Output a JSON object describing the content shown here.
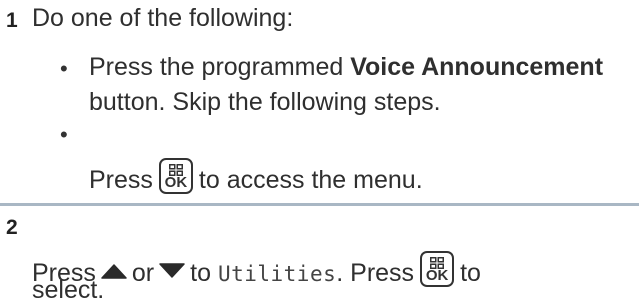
{
  "step1": {
    "number": "1",
    "intro": "Do one of the following:",
    "bullet1": {
      "pre": "Press the programmed ",
      "bold": "Voice Announcement",
      "line2": "button. Skip the following steps."
    },
    "bullet2": {
      "press": "Press",
      "key_label": "OK",
      "post": "to access the menu."
    }
  },
  "step2": {
    "number": "2",
    "press": "Press",
    "or": "or",
    "to": "to",
    "menu_item": "Utilities",
    "period": ".",
    "press2": "Press",
    "key_label": "OK",
    "to2": "to",
    "line2": "select."
  },
  "icons": {
    "menu_ok_key": "menu-ok-key-icon",
    "up_arrow": "up-arrow-icon",
    "down_arrow": "down-arrow-icon"
  }
}
